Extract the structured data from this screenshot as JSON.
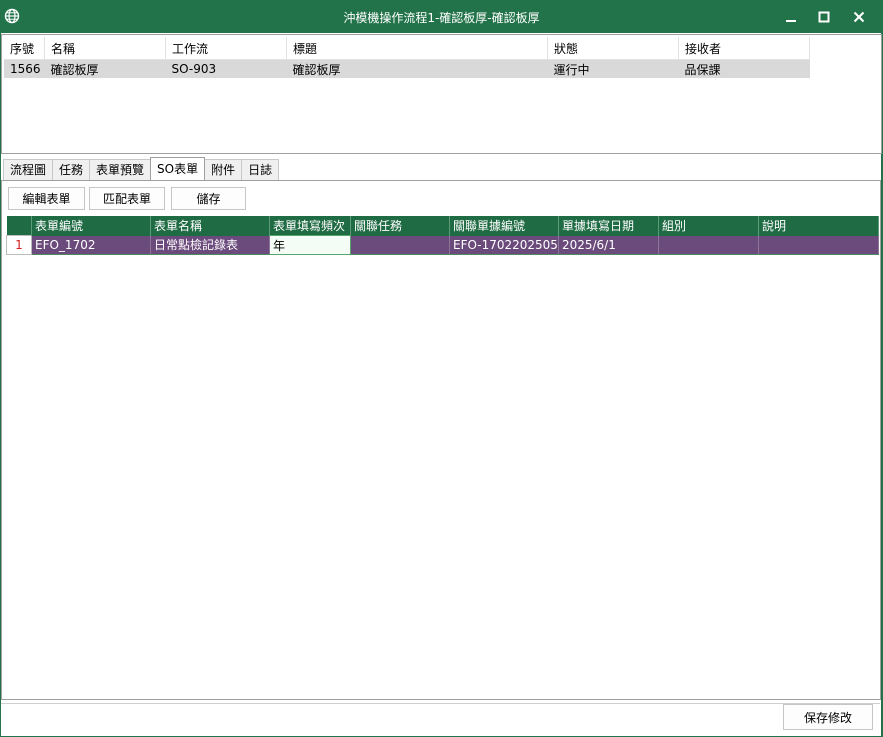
{
  "window": {
    "title": "沖模機操作流程1-確認板厚-確認板厚",
    "controls": {
      "minimize": "minimize",
      "maximize": "maximize",
      "close": "close"
    }
  },
  "top_table": {
    "headers": [
      "序號",
      "名稱",
      "工作流",
      "標題",
      "狀態",
      "接收者"
    ],
    "rows": [
      [
        "1566",
        "確認板厚",
        "SO-903",
        "確認板厚",
        "運行中",
        "品保課"
      ]
    ]
  },
  "tabs": [
    "流程圖",
    "任務",
    "表單預覽",
    "SO表單",
    "附件",
    "日誌"
  ],
  "active_tab": "SO表單",
  "toolbar": {
    "edit_label": "編輯表單",
    "match_label": "匹配表單",
    "save_label": "儲存"
  },
  "grid": {
    "headers": [
      "表單編號",
      "表單名稱",
      "表單填寫頻次",
      "關聯任務",
      "關聯單據編號",
      "單據填寫日期",
      "組別",
      "說明"
    ],
    "rows": [
      {
        "num": "1",
        "cells": [
          "EFO_1702",
          "日常點檢記錄表",
          "年",
          "",
          "EFO-1702202505",
          "2025/6/1",
          "",
          ""
        ]
      }
    ]
  },
  "footer": {
    "save_changes_label": "保存修改"
  },
  "colors": {
    "title_bar": "#22734a",
    "grid_header": "#1f6b44",
    "grid_row": "#6b4a7c",
    "row_number": "#d32020"
  }
}
